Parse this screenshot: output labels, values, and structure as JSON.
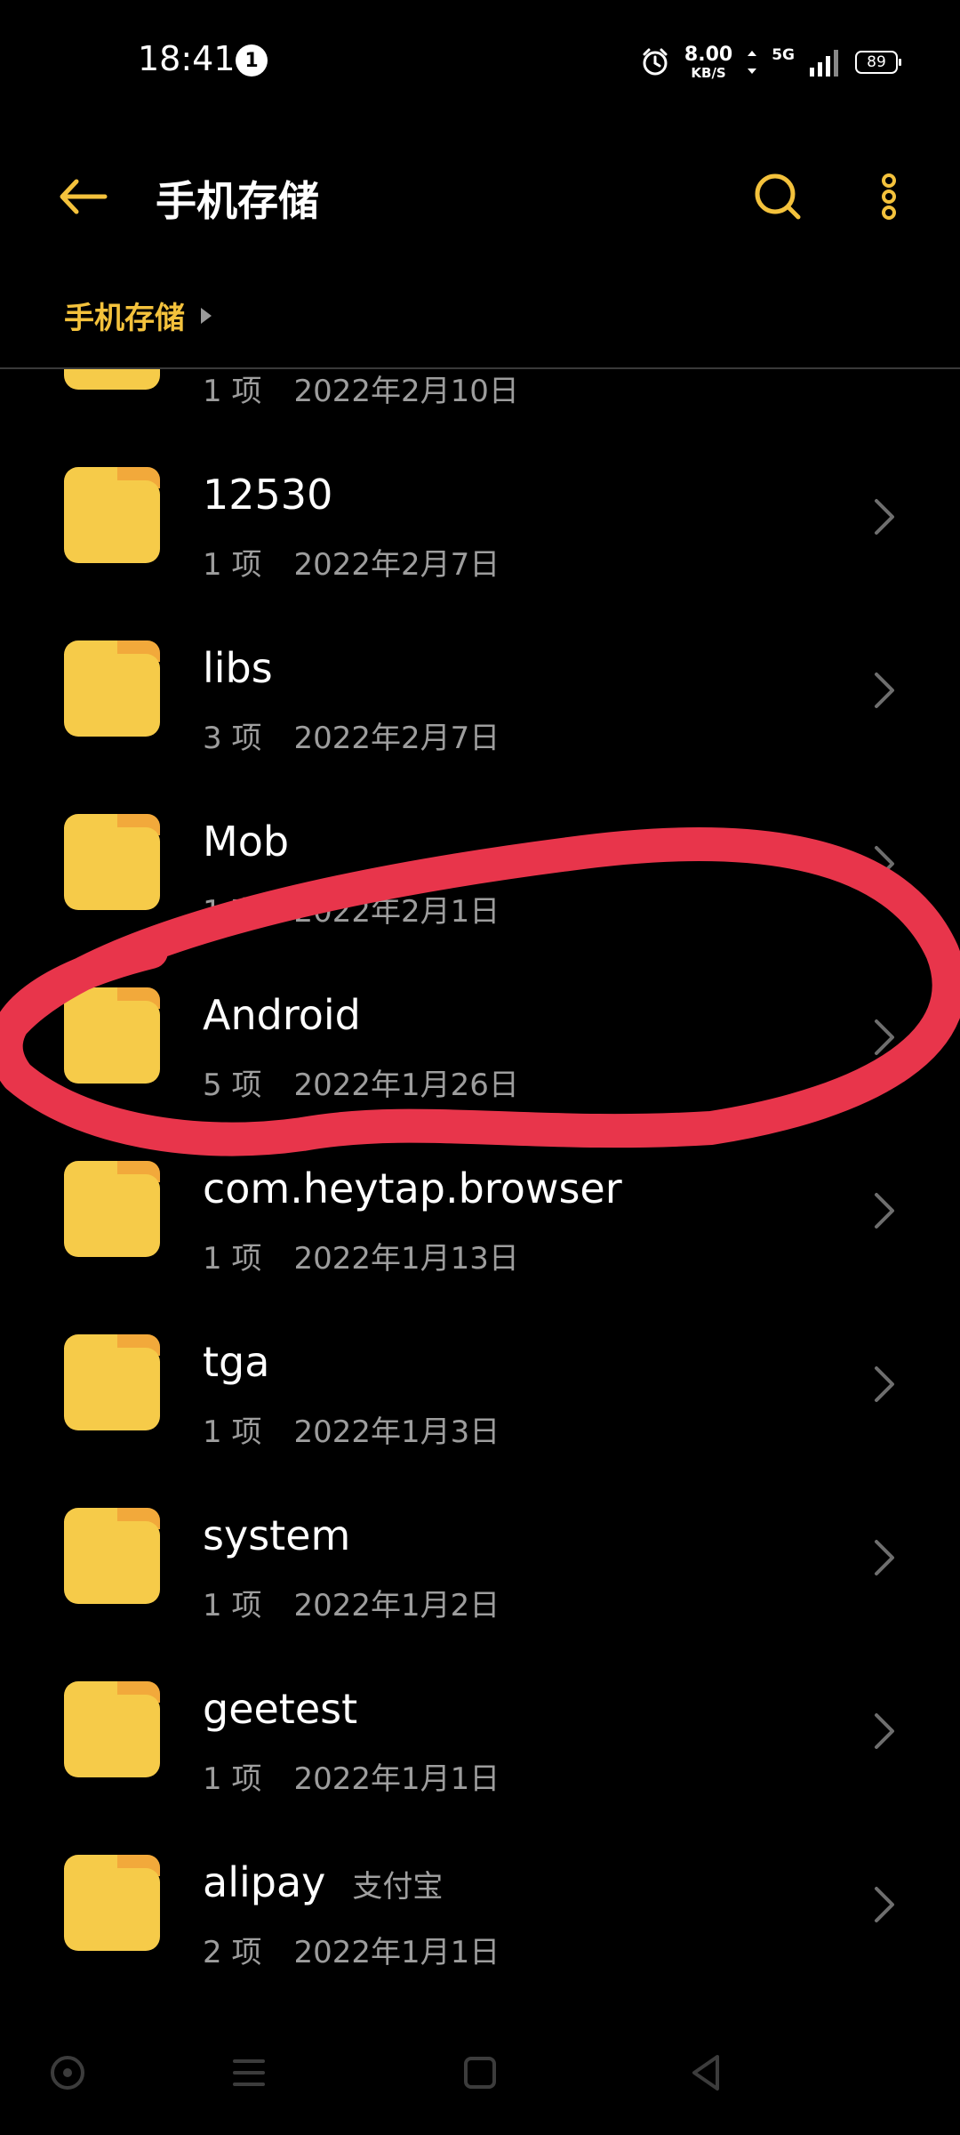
{
  "status_bar": {
    "time": "18:41",
    "notification_count": "1",
    "net_speed_value": "8.00",
    "net_speed_unit": "KB/S",
    "network": "5G",
    "battery": "89"
  },
  "toolbar": {
    "title": "手机存储",
    "icons": {
      "back": "back-arrow-icon",
      "search": "search-icon",
      "more": "more-vertical-icon"
    }
  },
  "breadcrumb": {
    "label": "手机存储"
  },
  "colors": {
    "accent": "#f4c23c",
    "folder": "#f6cb49",
    "folder_tab": "#f2a93b",
    "annotation": "#e8354b",
    "secondary_text": "#9d9d9d"
  },
  "files": [
    {
      "name": "",
      "alias": "",
      "count": "1 项",
      "date": "2022年2月10日"
    },
    {
      "name": "12530",
      "alias": "",
      "count": "1 项",
      "date": "2022年2月7日"
    },
    {
      "name": "libs",
      "alias": "",
      "count": "3 项",
      "date": "2022年2月7日"
    },
    {
      "name": "Mob",
      "alias": "",
      "count": "1 项",
      "date": "2022年2月1日"
    },
    {
      "name": "Android",
      "alias": "",
      "count": "5 项",
      "date": "2022年1月26日"
    },
    {
      "name": "com.heytap.browser",
      "alias": "",
      "count": "1 项",
      "date": "2022年1月13日"
    },
    {
      "name": "tga",
      "alias": "",
      "count": "1 项",
      "date": "2022年1月3日"
    },
    {
      "name": "system",
      "alias": "",
      "count": "1 项",
      "date": "2022年1月2日"
    },
    {
      "name": "geetest",
      "alias": "",
      "count": "1 项",
      "date": "2022年1月1日"
    },
    {
      "name": "alipay",
      "alias": "支付宝",
      "count": "2 项",
      "date": "2022年1月1日"
    }
  ],
  "nav_bar": {
    "icons": [
      "assistant-icon",
      "menu-icon",
      "home-icon",
      "back-icon"
    ]
  }
}
